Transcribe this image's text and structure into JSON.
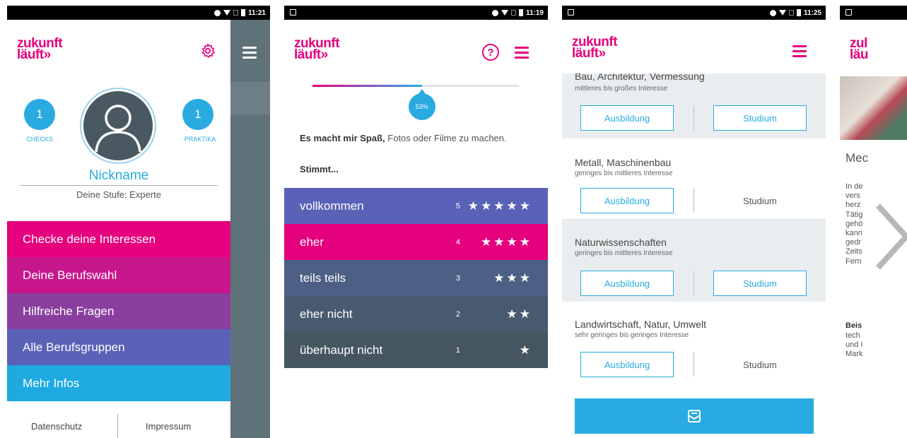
{
  "colors": {
    "magenta": "#e5007d",
    "blue": "#29abe2",
    "purple": "#8a3f9f",
    "indigo": "#5a62b8",
    "slate": "#4d5f6e",
    "dark_slate": "#465661",
    "gray_panel": "#eaedef"
  },
  "logo": {
    "line1": "zukunft",
    "line2": "läuft»"
  },
  "phone1": {
    "status_time": "11:21",
    "settings_icon": "gear-icon",
    "checks": {
      "count": "1",
      "label": "CHECKS"
    },
    "praktika": {
      "count": "1",
      "label": "PRAKTIKA"
    },
    "nickname": "Nickname",
    "level": "Deine Stufe: Experte",
    "menu": [
      {
        "label": "Checke deine Interessen",
        "color": "#e5007d"
      },
      {
        "label": "Deine Berufswahl",
        "color": "#c7168c"
      },
      {
        "label": "Hilfreiche Fragen",
        "color": "#8a3f9f"
      },
      {
        "label": "Alle Berufsgruppen",
        "color": "#5a62b8"
      },
      {
        "label": "Mehr Infos",
        "color": "#1fa9e1"
      }
    ],
    "footer": {
      "privacy": "Datenschutz",
      "imprint": "Impressum"
    }
  },
  "phone2": {
    "status_time": "11:19",
    "progress": {
      "percent": 53,
      "label": "53%"
    },
    "question_bold": "Es macht mir Spaß,",
    "question_rest": " Fotos oder Filme zu machen.",
    "prompt": "Stimmt...",
    "answers": [
      {
        "label": "vollkommen",
        "score": "5",
        "stars": "★★★★★",
        "color": "#5a62b8"
      },
      {
        "label": "eher",
        "score": "4",
        "stars": "★★★★",
        "color": "#e5007d"
      },
      {
        "label": "teils teils",
        "score": "3",
        "stars": "★★★",
        "color": "#4d5f84"
      },
      {
        "label": "eher nicht",
        "score": "2",
        "stars": "★★",
        "color": "#485a6e"
      },
      {
        "label": "überhaupt nicht",
        "score": "1",
        "stars": "★",
        "color": "#465661"
      }
    ]
  },
  "phone3": {
    "status_time": "11:25",
    "groups": [
      {
        "title": "Bau, Architektur, Vermessung",
        "interest": "mittleres bis großes Interesse",
        "ausbildung": "Ausbildung",
        "studium": "Studium",
        "studium_boxed": true,
        "shaded": true
      },
      {
        "title": "Metall, Maschinenbau",
        "interest": "geringes bis mittleres Interesse",
        "ausbildung": "Ausbildung",
        "studium": "Studium",
        "studium_boxed": false,
        "shaded": false
      },
      {
        "title": "Naturwissenschaften",
        "interest": "geringes bis mittleres Interesse",
        "ausbildung": "Ausbildung",
        "studium": "Studium",
        "studium_boxed": true,
        "shaded": true
      },
      {
        "title": "Landwirtschaft, Natur, Umwelt",
        "interest": "sehr geringes bis geringes Interesse",
        "ausbildung": "Ausbildung",
        "studium": "Studium",
        "studium_boxed": false,
        "shaded": false
      }
    ],
    "mail_icon": "mail-icon"
  },
  "phone4": {
    "logo1": "zul",
    "logo2": "läu",
    "title": "Mec",
    "text": "In de\nvers\nherz\nTätig\ngehö\nkann\ngedr\nZeits\nFern",
    "bold": "Beis",
    "text2": "tech\nund I\nMark"
  },
  "next_icon": "chevron-right-icon"
}
